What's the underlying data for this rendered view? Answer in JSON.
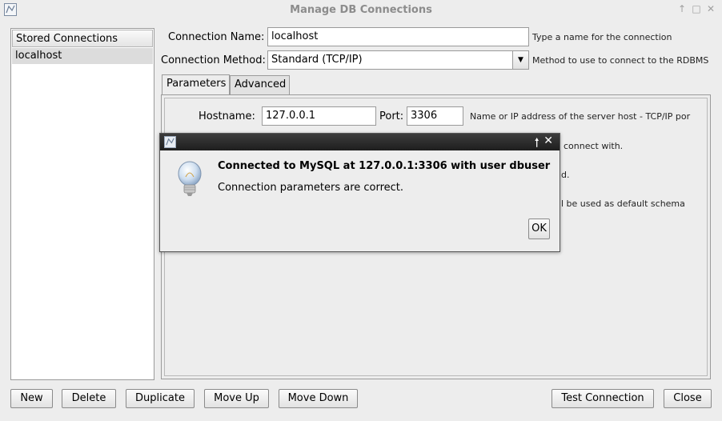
{
  "window": {
    "title": "Manage DB Connections"
  },
  "stored_connections": {
    "header": "Stored Connections",
    "items": [
      "localhost"
    ]
  },
  "form": {
    "connection_name_label": "Connection Name:",
    "connection_name_value": "localhost",
    "connection_name_hint": "Type a name for the connection",
    "connection_method_label": "Connection Method:",
    "connection_method_value": "Standard (TCP/IP)",
    "connection_method_hint": "Method to use to connect to the RDBMS"
  },
  "tabs": {
    "items": [
      "Parameters",
      "Advanced"
    ],
    "active": "Parameters"
  },
  "parameters": {
    "hostname_label": "Hostname:",
    "hostname_value": "127.0.0.1",
    "port_label": "Port:",
    "port_value": "3306",
    "hostname_hint": "Name or IP address of the server host - TCP/IP por",
    "username_hint_partial": "connect with.",
    "password_hint_partial": "d.",
    "schema_hint_partial": "l be used as default schema"
  },
  "buttons": {
    "new": "New",
    "delete": "Delete",
    "duplicate": "Duplicate",
    "move_up": "Move Up",
    "move_down": "Move Down",
    "test_connection": "Test Connection",
    "close": "Close"
  },
  "dialog": {
    "title_text": "Connected to MySQL at 127.0.0.1:3306 with user dbuser",
    "body_text": "Connection parameters are correct.",
    "ok_label": "OK",
    "icon": "lightbulb-icon"
  }
}
